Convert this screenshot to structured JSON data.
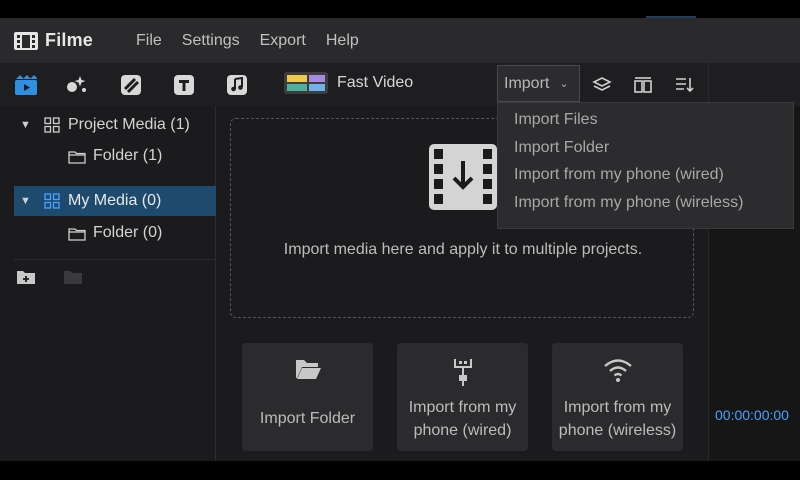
{
  "app": {
    "name": "Filme",
    "menu": [
      "File",
      "Settings",
      "Export",
      "Help"
    ]
  },
  "toolbar": {
    "icons": [
      "media-icon",
      "effects-icon",
      "transitions-icon",
      "text-icon",
      "music-icon"
    ],
    "fast_video_label": "Fast Video",
    "import_label": "Import"
  },
  "import_menu": {
    "items": [
      "Import Files",
      "Import Folder",
      "Import from my phone (wired)",
      "Import from my phone (wireless)"
    ]
  },
  "tree": {
    "project_media": "Project Media (1)",
    "project_folder": "Folder (1)",
    "my_media": "My Media (0)",
    "my_folder": "Folder (0)"
  },
  "main": {
    "dropzone_text": "Import media here and apply it to multiple projects.",
    "cards": [
      {
        "line1": "Import Folder",
        "line2": ""
      },
      {
        "line1": "Import from my",
        "line2": "phone (wired)"
      },
      {
        "line1": "Import from my",
        "line2": "phone (wireless)"
      }
    ]
  },
  "preview": {
    "timecode": "00:00:00:00"
  },
  "colors": {
    "accent": "#4aa3ff",
    "selection": "#1e4a6d",
    "toolbar_active": "#2f8fe0"
  }
}
